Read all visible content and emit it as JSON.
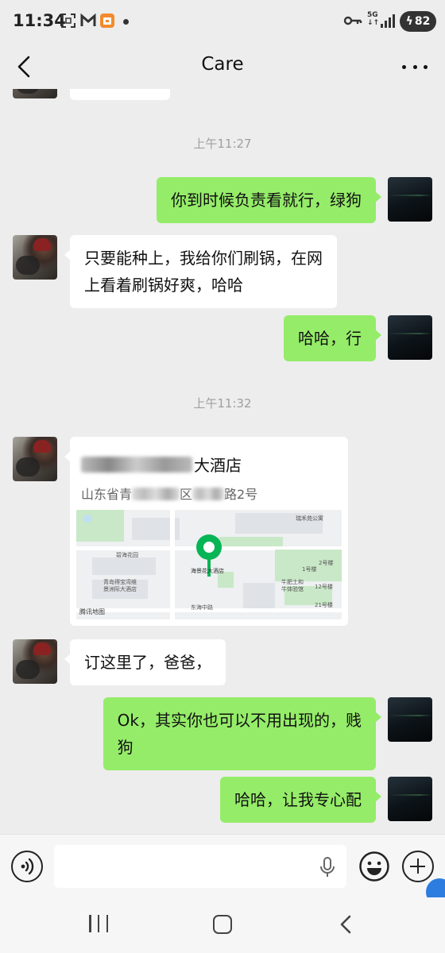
{
  "status_bar": {
    "time": "11:34",
    "network": "5G",
    "battery": "82"
  },
  "header": {
    "title": "Care"
  },
  "messages": [
    {
      "type": "timestamp",
      "text": "上午11:27"
    },
    {
      "side": "right",
      "text": "你到时候负责看就行，绿狗"
    },
    {
      "side": "left",
      "lines": [
        "只要能种上，我给你们刷锅，在网",
        "上看着刷锅好爽，哈哈"
      ]
    },
    {
      "side": "right",
      "text": "哈哈，行"
    },
    {
      "type": "timestamp",
      "text": "上午11:32"
    },
    {
      "side": "right",
      "text": ""
    },
    {
      "side": "left",
      "text": "订这里了，爸爸，"
    },
    {
      "side": "right",
      "lines": [
        "Ok，其实你也可以不用出现的，贱",
        "狗"
      ]
    },
    {
      "side": "right",
      "text": "哈哈，让我专心配"
    }
  ],
  "location": {
    "name_visible": "大酒店",
    "address_prefix": "山东省青",
    "address_mid": "区",
    "address_suffix": "路2号",
    "map_labels": [
      "瑞禾苑公寓",
      "碧海花园",
      "青岛得宝湾维",
      "景洲际大酒店",
      "海景花",
      "大酒店",
      "2号楼",
      "1号楼",
      "牛肥土和",
      "牛体验馆",
      "12号楼",
      "21号楼",
      "东海中路"
    ],
    "map_brand": "腾讯地图"
  },
  "colors": {
    "sent_bubble": "#95ec69",
    "received_bubble": "#ffffff",
    "background": "#ededed",
    "pin": "#08b556"
  },
  "icons": {
    "voice": "voice-icon",
    "mic": "mic-icon",
    "emoji": "emoji-icon",
    "plus": "plus-icon"
  }
}
